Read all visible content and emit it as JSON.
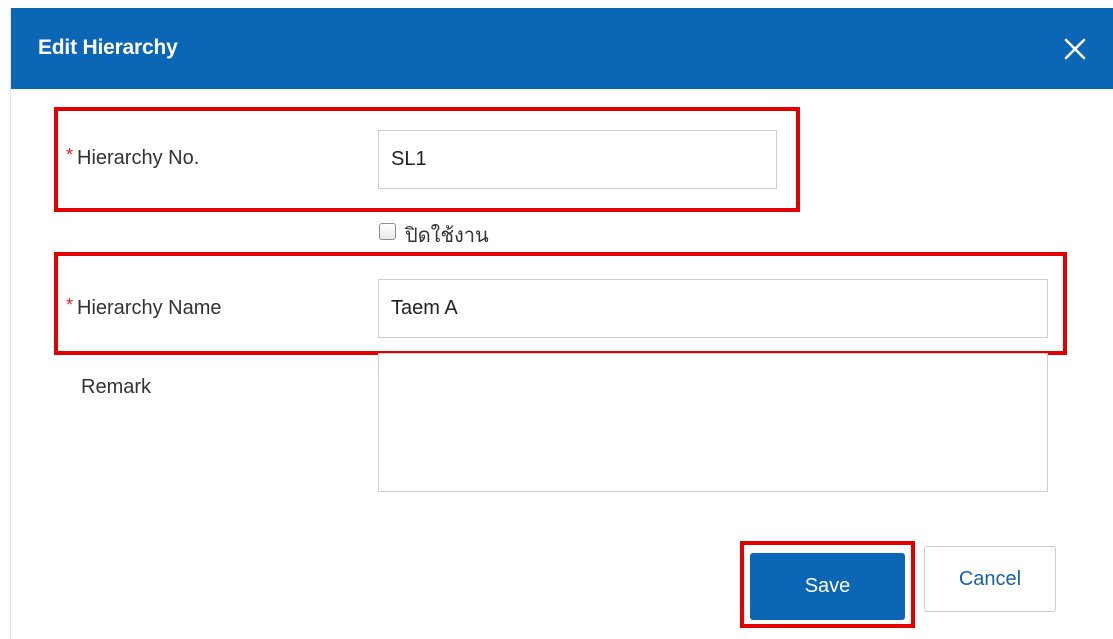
{
  "dialog": {
    "title": "Edit Hierarchy",
    "close_icon": "close-icon"
  },
  "form": {
    "required_marker": "*",
    "hierarchy_no": {
      "label": "Hierarchy No.",
      "value": "SL1"
    },
    "disable": {
      "label": "ปิดใช้งาน",
      "checked": false
    },
    "hierarchy_name": {
      "label": "Hierarchy Name",
      "value": "Taem A"
    },
    "remark": {
      "label": "Remark",
      "value": ""
    }
  },
  "actions": {
    "save_label": "Save",
    "cancel_label": "Cancel"
  },
  "colors": {
    "header": "#0b66b5",
    "highlight": "#e30000",
    "required": "#e62020",
    "save_button": "#0b66b5",
    "cancel_text": "#1a5fa8"
  }
}
